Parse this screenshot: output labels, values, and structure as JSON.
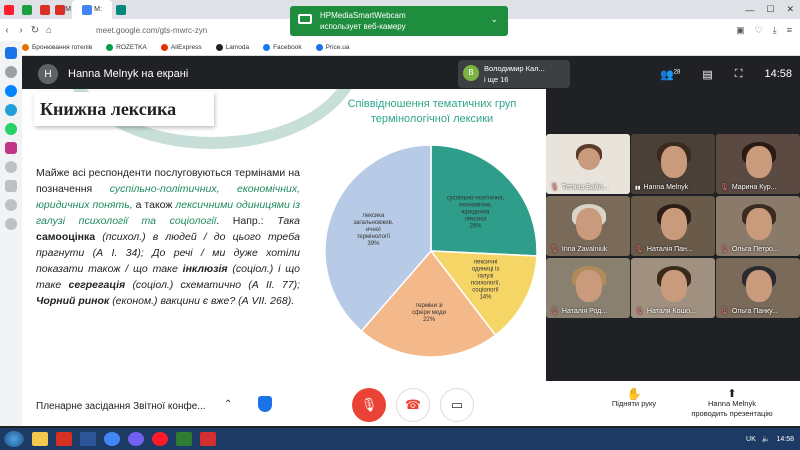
{
  "browser": {
    "tabs": [
      {
        "label": "",
        "icon": "opera-tab-icon",
        "color": "#ff1b2d"
      },
      {
        "label": "",
        "icon": "hotline-tab-icon",
        "color": "#1b9e3e"
      },
      {
        "label": "",
        "icon": "gmail-tab-icon",
        "color": "#d93025"
      },
      {
        "label": "M",
        "icon": "gmail-tab-icon",
        "color": "#d93025"
      },
      {
        "label": "M:",
        "icon": "google-tab-icon",
        "color": "#4285f4",
        "active": true
      },
      {
        "label": "",
        "icon": "meet-tab-icon",
        "color": "#00897b"
      }
    ],
    "address": "meet.google.com/gts-mwrc-zyn",
    "bookmarks": [
      "Бронювання готелів",
      "ROZETKA",
      "AliExpress",
      "Lamoda",
      "Facebook",
      "Price.ua"
    ]
  },
  "toast": {
    "title": "HPMediaSmartWebcam",
    "subtitle": "использует веб-камеру"
  },
  "meet": {
    "presenter_initial": "H",
    "presenter_label": "Hanna Melnyk на екрані",
    "speaker": {
      "initial": "В",
      "name": "Володимир Кал...",
      "more": "і ще 16"
    },
    "people_count": "28",
    "time": "14:58",
    "meeting_title": "Пленарне засідання Звітної конфе...",
    "raise_hand": "Підняти руку",
    "presenting_name": "Hanna Melnyk",
    "presenting_action": "проводить презентацію"
  },
  "slide": {
    "title": "Книжна лексика",
    "chart_title": "Співвідношення тематичних груп термінологічної лексики",
    "body": {
      "p1": "Майже всі респонденти послуговуються термінами на позначення",
      "p2": "суспільно-політичних, економічних, юридичних понять,",
      "p3": "а також",
      "p4": "лексичними одиницями із галузі психології та соціології",
      "p5": ". Напр.:",
      "p6": "Така",
      "p7": "самооцінка",
      "p8": "(психол.) в людей / до цього треба прагнути (А І. 34); До речі / ми дуже хотіли показати також / що таке",
      "p9": "інклюзія",
      "p10": "(соціол.) і що таке",
      "p11": "сегрегація",
      "p12": "(соціол.) схематично (А ІІ. 77);",
      "p13": "Чорний ринок",
      "p14": "(економ.) вакцини є вже? (А VII. 268)."
    }
  },
  "chart_data": {
    "type": "pie",
    "title": "Співвідношення тематичних груп термінологічної лексики",
    "slices": [
      {
        "label": "суспільно-політична, економічна, юридична лексика",
        "value": 26,
        "color": "#2e9e8a"
      },
      {
        "label": "лексичні одиниці із галузі психології, соціології",
        "value": 14,
        "color": "#f5d565"
      },
      {
        "label": "терміни зі сфери моди",
        "value": 22,
        "color": "#f4b98a"
      },
      {
        "label": "лексика загальновжив. ичної термінології",
        "value": 39,
        "color": "#b8cbe6"
      }
    ],
    "labels": [
      "26%",
      "14%",
      "22%",
      "39%"
    ]
  },
  "participants": [
    {
      "name": "Тетяна Байл...",
      "muted": true,
      "bg": "#e8e4dc",
      "hair": "#5a3a2a",
      "avatar": true
    },
    {
      "name": "Hanna Melnyk",
      "muted": false,
      "bg": "#4a4038",
      "hair": "#3a2a1e"
    },
    {
      "name": "Марина Кур...",
      "muted": true,
      "bg": "#5a4a42",
      "hair": "#2a1a14"
    },
    {
      "name": "Inna Zavalniuk",
      "muted": true,
      "bg": "#7a6a5a",
      "hair": "#d9d4c8"
    },
    {
      "name": "Наталія Пан...",
      "muted": true,
      "bg": "#6a5a4a",
      "hair": "#2a1e16"
    },
    {
      "name": "Ольга Петро...",
      "muted": true,
      "bg": "#8a7a6a",
      "hair": "#3a2a20"
    },
    {
      "name": "Наталія Род...",
      "muted": true,
      "bg": "#8a8070",
      "hair": "#b08a5a"
    },
    {
      "name": "Наталя Кошо...",
      "muted": true,
      "bg": "#a09080",
      "hair": "#3a2a1a"
    },
    {
      "name": "Ольга Панку...",
      "muted": true,
      "bg": "#7a6a5a",
      "hair": "#2a2a30"
    }
  ],
  "taskbar": {
    "lang": "UK",
    "time": "14:58"
  },
  "colors": {
    "meet_bg": "#202124",
    "end_call": "#ea4335",
    "accent": "#2fa58a"
  }
}
